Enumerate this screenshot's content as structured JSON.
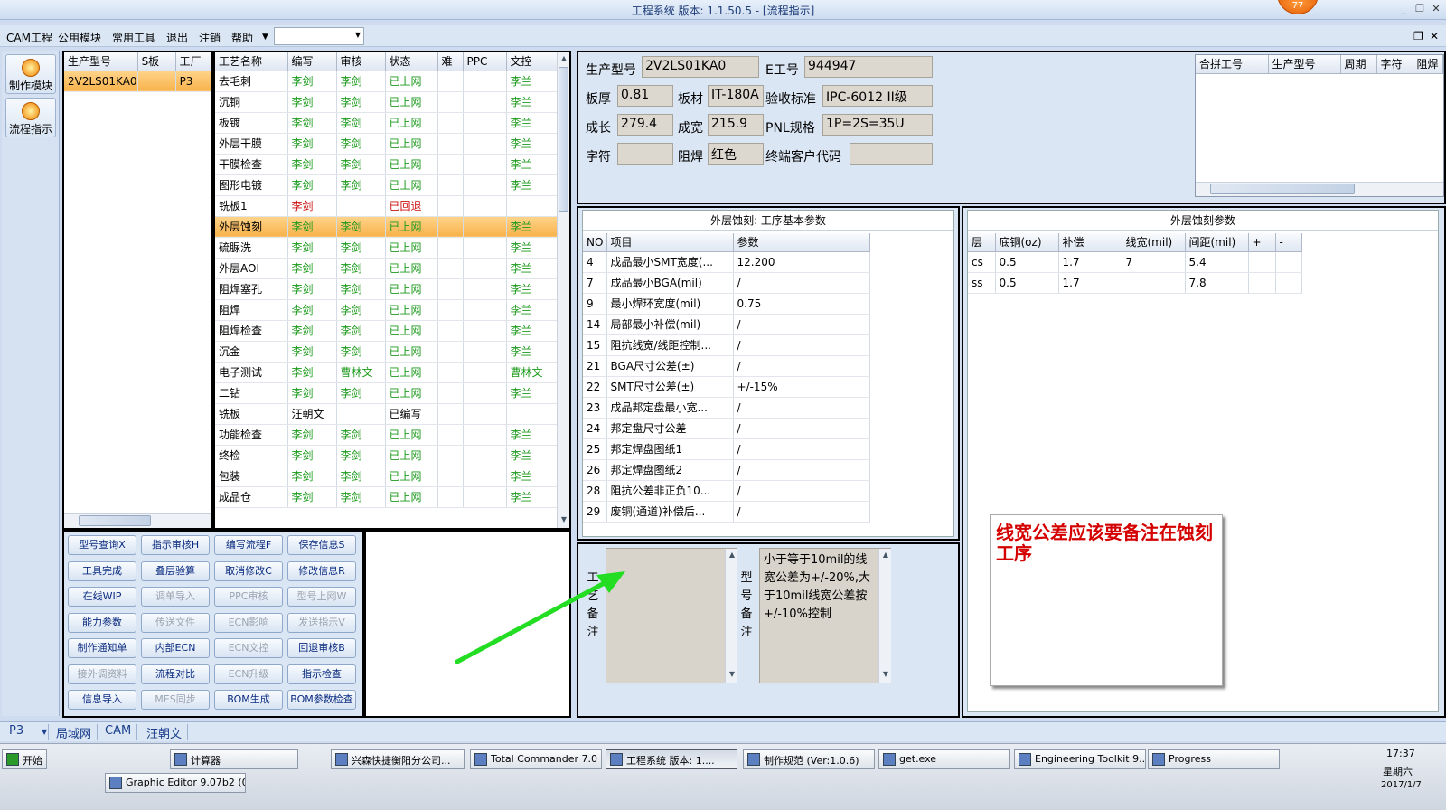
{
  "window": {
    "title": "工程系统   版本: 1.1.50.5 - [流程指示]",
    "badge": "77"
  },
  "menu": {
    "items": [
      "CAM工程",
      "公用模块",
      "常用工具",
      "退出",
      "注销",
      "帮助"
    ],
    "combo_value": ""
  },
  "nav": {
    "buttons": [
      "制作模块",
      "流程指示"
    ]
  },
  "model_list": {
    "headers": [
      "生产型号",
      "S板",
      "工厂"
    ],
    "rows": [
      [
        "2V2LS01KA0",
        "",
        "P3"
      ]
    ]
  },
  "process": {
    "headers": [
      "工艺名称",
      "编写",
      "审核",
      "状态",
      "难",
      "PPC",
      "文控"
    ],
    "rows": [
      [
        "去毛刺",
        "李剑",
        "李剑",
        "已上网",
        "",
        "",
        "李兰"
      ],
      [
        "沉铜",
        "李剑",
        "李剑",
        "已上网",
        "",
        "",
        "李兰"
      ],
      [
        "板镀",
        "李剑",
        "李剑",
        "已上网",
        "",
        "",
        "李兰"
      ],
      [
        "外层干膜",
        "李剑",
        "李剑",
        "已上网",
        "",
        "",
        "李兰"
      ],
      [
        "干膜检查",
        "李剑",
        "李剑",
        "已上网",
        "",
        "",
        "李兰"
      ],
      [
        "图形电镀",
        "李剑",
        "李剑",
        "已上网",
        "",
        "",
        "李兰"
      ],
      [
        "铣板1",
        "李剑",
        "",
        "已回退",
        "",
        "",
        ""
      ],
      [
        "外层蚀刻",
        "李剑",
        "李剑",
        "已上网",
        "",
        "",
        "李兰"
      ],
      [
        "硫脲洗",
        "李剑",
        "李剑",
        "已上网",
        "",
        "",
        "李兰"
      ],
      [
        "外层AOI",
        "李剑",
        "李剑",
        "已上网",
        "",
        "",
        "李兰"
      ],
      [
        "阻焊塞孔",
        "李剑",
        "李剑",
        "已上网",
        "",
        "",
        "李兰"
      ],
      [
        "阻焊",
        "李剑",
        "李剑",
        "已上网",
        "",
        "",
        "李兰"
      ],
      [
        "阻焊检查",
        "李剑",
        "李剑",
        "已上网",
        "",
        "",
        "李兰"
      ],
      [
        "沉金",
        "李剑",
        "李剑",
        "已上网",
        "",
        "",
        "李兰"
      ],
      [
        "电子测试",
        "李剑",
        "曹林文",
        "已上网",
        "",
        "",
        "曹林文"
      ],
      [
        "二钻",
        "李剑",
        "李剑",
        "已上网",
        "",
        "",
        "李兰"
      ],
      [
        "铣板",
        "汪朝文",
        "",
        "已编写",
        "",
        "",
        ""
      ],
      [
        "功能检查",
        "李剑",
        "李剑",
        "已上网",
        "",
        "",
        "李兰"
      ],
      [
        "终检",
        "李剑",
        "李剑",
        "已上网",
        "",
        "",
        "李兰"
      ],
      [
        "包装",
        "李剑",
        "李剑",
        "已上网",
        "",
        "",
        "李兰"
      ],
      [
        "成品仓",
        "李剑",
        "李剑",
        "已上网",
        "",
        "",
        "李兰"
      ]
    ]
  },
  "actions": {
    "rows": [
      [
        "型号查询X",
        "指示审核H",
        "编写流程F",
        "保存信息S"
      ],
      [
        "工具完成",
        "叠层验算",
        "取消修改C",
        "修改信息R"
      ],
      [
        "在线WIP",
        "调单导入",
        "PPC审核",
        "型号上网W"
      ],
      [
        "能力参数",
        "传送文件",
        "ECN影响",
        "发送指示V"
      ],
      [
        "制作通知单",
        "内部ECN",
        "ECN文控",
        "回退审核B"
      ],
      [
        "接外调资料",
        "流程对比",
        "ECN升级",
        "指示检查"
      ],
      [
        "信息导入",
        "MES同步",
        "BOM生成",
        "BOM参数检查"
      ]
    ],
    "disabled": [
      "调单导入",
      "PPC审核",
      "型号上网W",
      "传送文件",
      "ECN影响",
      "发送指示V",
      "ECN文控",
      "接外调资料",
      "ECN升级",
      "MES同步"
    ]
  },
  "info": {
    "labels": {
      "model": "生产型号",
      "eno": "E工号",
      "thick": "板厚",
      "mat": "板材",
      "std": "验收标准",
      "len": "成长",
      "wid": "成宽",
      "pnl": "PNL规格",
      "char": "字符",
      "mask": "阻焊",
      "cust": "终端客户代码"
    },
    "values": {
      "model": "2V2LS01KA0",
      "eno": "944947",
      "thick": "0.81",
      "mat": "IT-180A",
      "std": "IPC-6012 II级",
      "len": "279.4",
      "wid": "215.9",
      "pnl": "1P=2S=35U",
      "char": "",
      "mask": "红色",
      "cust": ""
    }
  },
  "panel_table": {
    "headers": [
      "合拼工号",
      "生产型号",
      "周期",
      "字符",
      "阻焊"
    ]
  },
  "basic": {
    "title": "外层蚀刻: 工序基本参数",
    "headers": [
      "NO",
      "项目",
      "参数"
    ],
    "rows": [
      [
        "4",
        "成品最小SMT宽度(...",
        "12.200"
      ],
      [
        "7",
        "成品最小BGA(mil)",
        "/"
      ],
      [
        "9",
        "最小焊环宽度(mil)",
        "0.75"
      ],
      [
        "14",
        "局部最小补偿(mil)",
        "/"
      ],
      [
        "15",
        "阻抗线宽/线距控制...",
        "/"
      ],
      [
        "21",
        "BGA尺寸公差(±)",
        "/"
      ],
      [
        "22",
        "SMT尺寸公差(±)",
        "+/-15%"
      ],
      [
        "23",
        "成品邦定盘最小宽...",
        "/"
      ],
      [
        "24",
        "邦定盘尺寸公差",
        "/"
      ],
      [
        "25",
        "邦定焊盘图纸1",
        "/"
      ],
      [
        "26",
        "邦定焊盘图纸2",
        "/"
      ],
      [
        "28",
        "阻抗公差非正负10...",
        "/"
      ],
      [
        "29",
        "废铜(通道)补偿后...",
        "/"
      ]
    ]
  },
  "etch": {
    "title": "外层蚀刻参数",
    "headers": [
      "层",
      "底铜(oz)",
      "补偿",
      "线宽(mil)",
      "间距(mil)",
      "+",
      "-"
    ],
    "rows": [
      [
        "cs",
        "0.5",
        "1.7",
        "7",
        "5.4",
        "",
        ""
      ],
      [
        "ss",
        "0.5",
        "1.7",
        "",
        "7.8",
        "",
        ""
      ]
    ]
  },
  "remarks": {
    "process_label": "工艺备注",
    "process_text": "",
    "model_label": "型号备注",
    "model_text": "小于等于10mil的线宽公差为+/-20%,大于10mil线宽公差按+/-10%控制"
  },
  "annotation": {
    "text": "线宽公差应该要备注在蚀刻工序",
    "arrow_color": "#22dd22"
  },
  "statusbar": {
    "items": [
      "P3",
      "局域网",
      "CAM",
      "汪朝文"
    ]
  },
  "taskbar": {
    "start": "开始",
    "row1": [
      "计算器",
      "兴森快捷衡阳分公司...",
      "Total Commander 7.0 ...",
      "工程系统  版本: 1....",
      "制作规范 (Ver:1.0.6)",
      "get.exe",
      "Engineering Toolkit 9....",
      "Progress"
    ],
    "row2": [
      "Graphic Editor 9.07b2 (0..."
    ],
    "time": "17:37",
    "weekday": "星期六",
    "date": "2017/1/7"
  }
}
